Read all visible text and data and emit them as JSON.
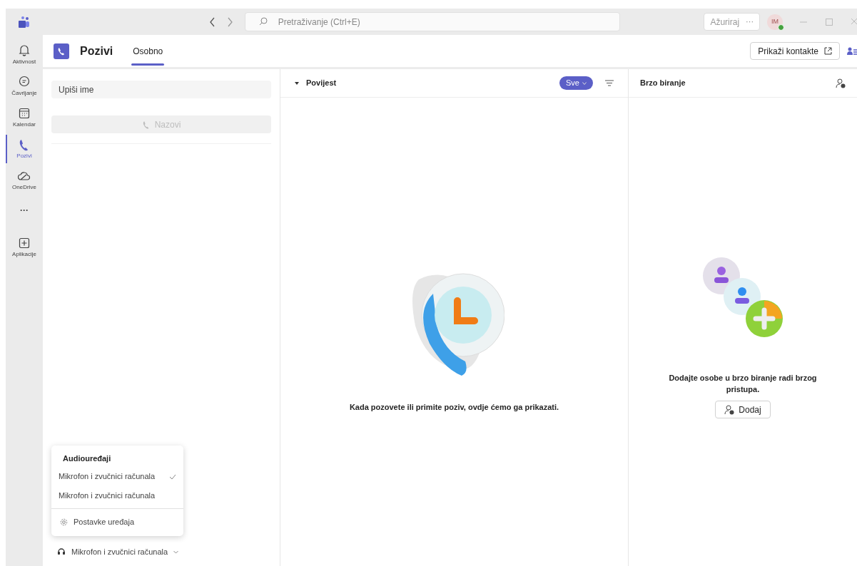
{
  "titlebar": {
    "search_placeholder": "Pretraživanje (Ctrl+E)",
    "update_button": "Ažuriraj",
    "more": "···",
    "avatar_initials": "IM"
  },
  "rail": [
    {
      "label": "Aktivnost",
      "kind": "bell",
      "selected": false
    },
    {
      "label": "Čavrljanje",
      "kind": "chat",
      "selected": false
    },
    {
      "label": "Kalendar",
      "kind": "calendar",
      "selected": false
    },
    {
      "label": "Pozivi",
      "kind": "phone",
      "selected": true
    },
    {
      "label": "OneDrive",
      "kind": "cloud",
      "selected": false
    },
    {
      "label": "···",
      "kind": "more",
      "selected": false
    },
    {
      "label": "Aplikacije",
      "kind": "apps",
      "selected": false
    }
  ],
  "header": {
    "title": "Pozivi",
    "tabs": [
      {
        "label": "Osobno",
        "selected": true
      }
    ],
    "contacts_button": "Prikaži kontakte"
  },
  "dialer": {
    "name_placeholder": "Upiši ime",
    "call_button": {
      "label": "Nazovi",
      "disabled": true
    }
  },
  "audio_menu": {
    "title": "Audiouređaji",
    "items": [
      {
        "label": "Mikrofon i zvučnici računala",
        "checked": true
      },
      {
        "label": "Mikrofon i zvučnici računala",
        "checked": false
      }
    ],
    "settings": "Postavke uređaja",
    "current_device": "Mikrofon i zvučnici računala"
  },
  "history": {
    "title": "Povijest",
    "filter": "Sve",
    "empty_message": "Kada pozovete ili primite poziv, ovdje ćemo ga prikazati."
  },
  "speed_dial": {
    "title": "Brzo biranje",
    "empty_message": "Dodajte osobe u brzo biranje radi brzog pristupa.",
    "add_button": "Dodaj"
  }
}
